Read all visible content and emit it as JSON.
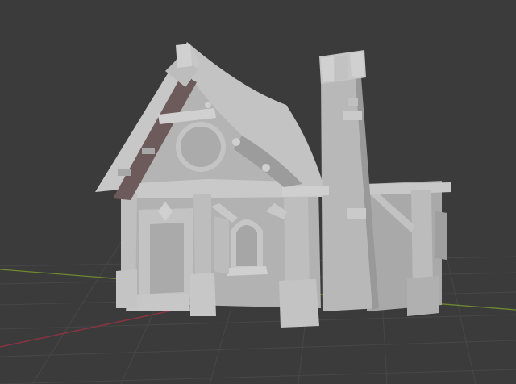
{
  "viewport": {
    "background": "#3b3b3b",
    "grid_color": "#474747",
    "x_axis_color": "#8a3340",
    "y_axis_color": "#6e8a2e"
  },
  "model": {
    "name_hint": "stylized-cottage",
    "base_color": "#b4b4b4",
    "shadow_color": "#8f8f8f",
    "dark_color": "#6d5a5a",
    "highlight_color": "#d3d3d3"
  }
}
